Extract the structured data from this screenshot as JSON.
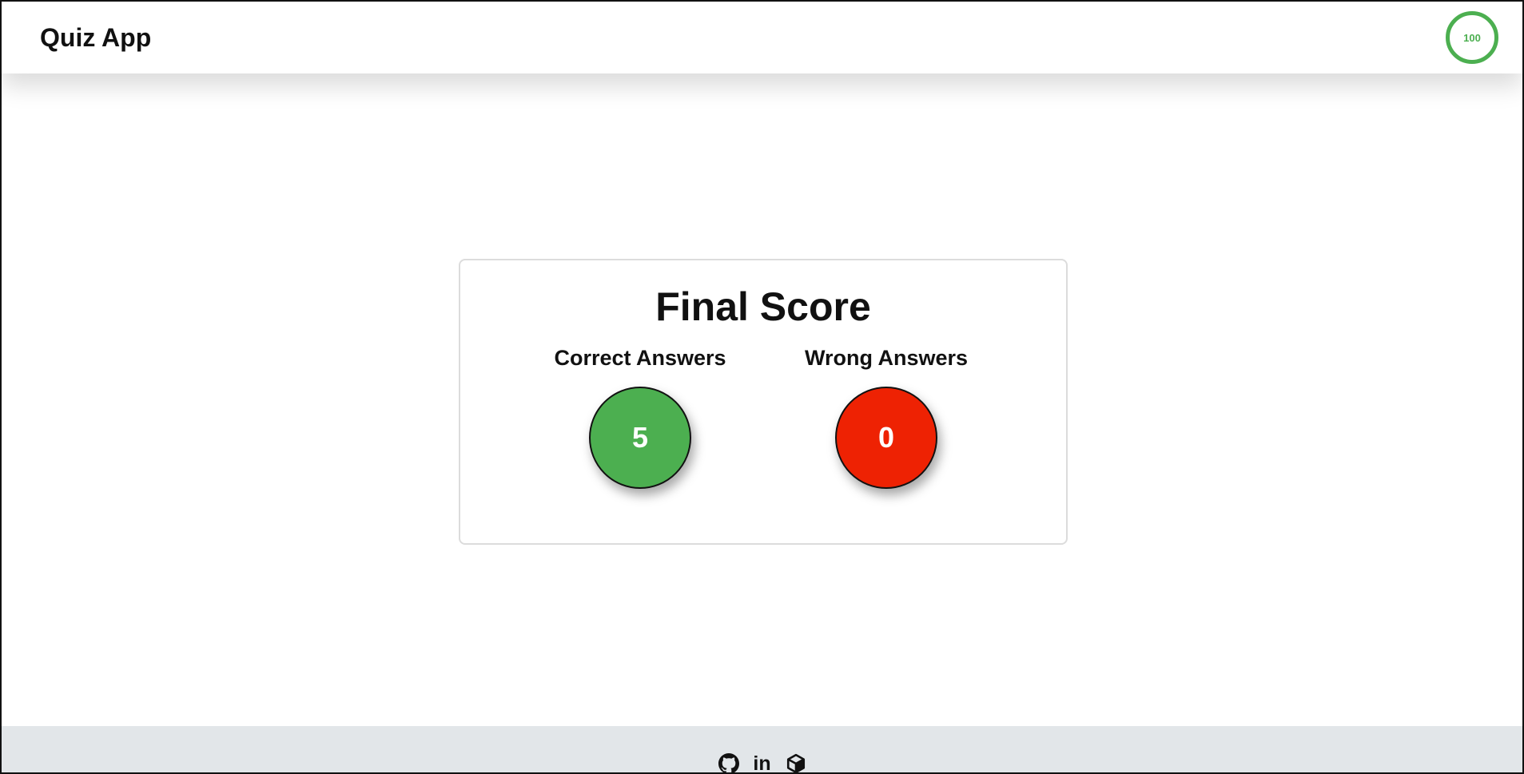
{
  "header": {
    "title": "Quiz App",
    "timer_value": "100"
  },
  "score": {
    "title": "Final Score",
    "correct_label": "Correct Answers",
    "correct_value": "5",
    "wrong_label": "Wrong Answers",
    "wrong_value": "0"
  },
  "footer": {
    "links": [
      {
        "icon": "github-icon"
      },
      {
        "icon": "linkedin-icon",
        "text": "in"
      },
      {
        "icon": "codesandbox-icon"
      }
    ]
  },
  "colors": {
    "correct": "#4caf50",
    "wrong": "#ee2203",
    "timer": "#4caf50",
    "footer_bg": "#e2e6e9"
  }
}
